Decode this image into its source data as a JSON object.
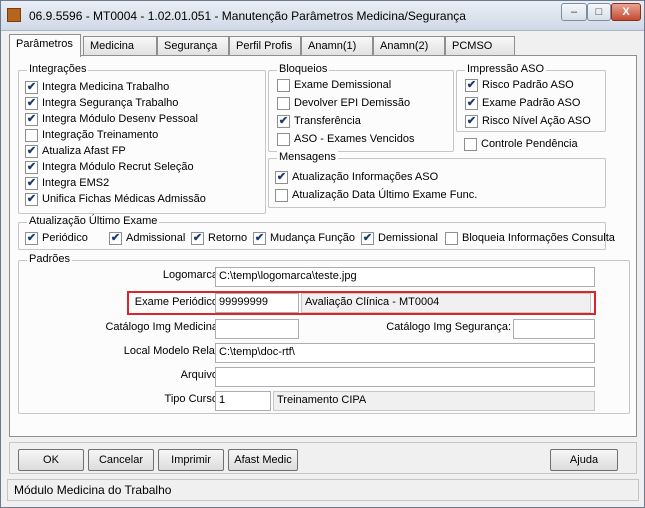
{
  "window": {
    "title": "06.9.5596 - MT0004 - 1.02.01.051 - Manutenção Parâmetros Medicina/Segurança",
    "minimize": "–",
    "maximize": "□",
    "close": "X"
  },
  "tabs": [
    "Parâmetros",
    "Medicina",
    "Segurança",
    "Perfil Profis",
    "Anamn(1)",
    "Anamn(2)",
    "PCMSO"
  ],
  "integracoes": {
    "title": "Integrações",
    "items": [
      {
        "label": "Integra Medicina Trabalho",
        "checked": true
      },
      {
        "label": "Integra Segurança Trabalho",
        "checked": true
      },
      {
        "label": "Integra Módulo Desenv Pessoal",
        "checked": true
      },
      {
        "label": "Integração Treinamento",
        "checked": false
      },
      {
        "label": "Atualiza Afast FP",
        "checked": true
      },
      {
        "label": "Integra Módulo Recrut Seleção",
        "checked": true
      },
      {
        "label": "Integra EMS2",
        "checked": true
      },
      {
        "label": "Unifica Fichas Médicas Admissão",
        "checked": true
      }
    ]
  },
  "bloqueios": {
    "title": "Bloqueios",
    "items": [
      {
        "label": "Exame Demissional",
        "checked": false
      },
      {
        "label": "Devolver EPI Demissão",
        "checked": false
      },
      {
        "label": "Transferência",
        "checked": true
      },
      {
        "label": "ASO - Exames Vencidos",
        "checked": false
      }
    ]
  },
  "impressao": {
    "title": "Impressão ASO",
    "items": [
      {
        "label": "Risco Padrão ASO",
        "checked": true
      },
      {
        "label": "Exame Padrão ASO",
        "checked": true
      },
      {
        "label": "Risco Nível Ação ASO",
        "checked": true
      }
    ]
  },
  "controle_pendencia": {
    "label": "Controle Pendência",
    "checked": false
  },
  "mensagens": {
    "title": "Mensagens",
    "items": [
      {
        "label": "Atualização Informações ASO",
        "checked": true
      },
      {
        "label": "Atualização Data Último Exame Func.",
        "checked": false
      }
    ]
  },
  "atualizacao": {
    "title": "Atualização Último Exame",
    "items": [
      {
        "label": "Periódico",
        "checked": true
      },
      {
        "label": "Admissional",
        "checked": true
      },
      {
        "label": "Retorno",
        "checked": true
      },
      {
        "label": "Mudança Função",
        "checked": true
      },
      {
        "label": "Demissional",
        "checked": true
      },
      {
        "label": "Bloqueia Informações Consulta",
        "checked": false
      }
    ]
  },
  "padroes": {
    "title": "Padrões",
    "logomarca_label": "Logomarca:",
    "logomarca_value": "C:\\temp\\logomarca\\teste.jpg",
    "exame_label": "Exame Periódico:",
    "exame_code": "99999999",
    "exame_desc": "Avaliação Clínica - MT0004",
    "catalogo_med_label": "Catálogo Img Medicina:",
    "catalogo_med_value": "",
    "catalogo_seg_label": "Catálogo Img Segurança:",
    "catalogo_seg_value": "",
    "local_label": "Local Modelo Relat:",
    "local_value": "C:\\temp\\doc-rtf\\",
    "arquivo_label": "Arquivo:",
    "arquivo_value": "",
    "tipo_label": "Tipo Curso:",
    "tipo_code": "1",
    "tipo_desc": "Treinamento CIPA"
  },
  "buttons": {
    "ok": "OK",
    "cancelar": "Cancelar",
    "imprimir": "Imprimir",
    "afast": "Afast Medic",
    "ajuda": "Ajuda"
  },
  "status": "Módulo Medicina do Trabalho",
  "colors": {
    "highlight": "#d9262c"
  }
}
